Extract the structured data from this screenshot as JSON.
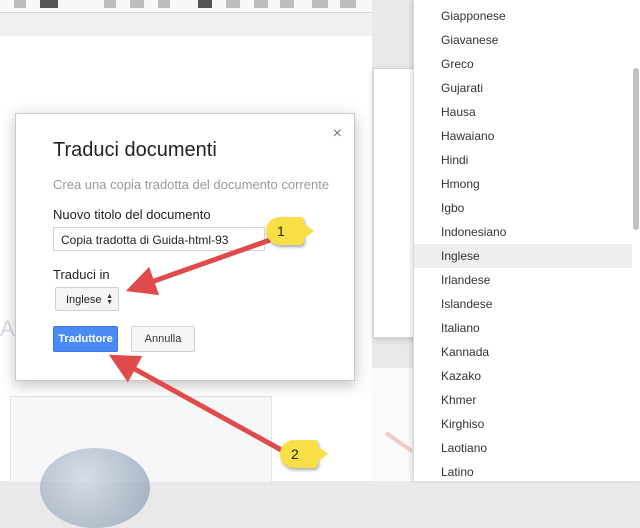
{
  "dialog": {
    "title": "Traduci documenti",
    "subtitle": "Crea una copia tradotta del documento corrente",
    "close_symbol": "×",
    "new_title_label": "Nuovo titolo del documento",
    "new_title_value": "Copia tradotta di Guida-html-93",
    "translate_to_label": "Traduci in",
    "selected_language": "Inglese",
    "translate_button": "Traduttore",
    "cancel_button": "Annulla"
  },
  "language_list": [
    "Giapponese",
    "Giavanese",
    "Greco",
    "Gujarati",
    "Hausa",
    "Hawaiano",
    "Hindi",
    "Hmong",
    "Igbo",
    "Indonesiano",
    "Inglese",
    "Irlandese",
    "Islandese",
    "Italiano",
    "Kannada",
    "Kazako",
    "Khmer",
    "Kirghiso",
    "Laotiano",
    "Latino"
  ],
  "highlighted_language": "Inglese",
  "callouts": [
    "1",
    "2"
  ],
  "colors": {
    "primary_button": "#4a8af4",
    "arrow": "#e04a4a",
    "callout": "#f7df45"
  }
}
